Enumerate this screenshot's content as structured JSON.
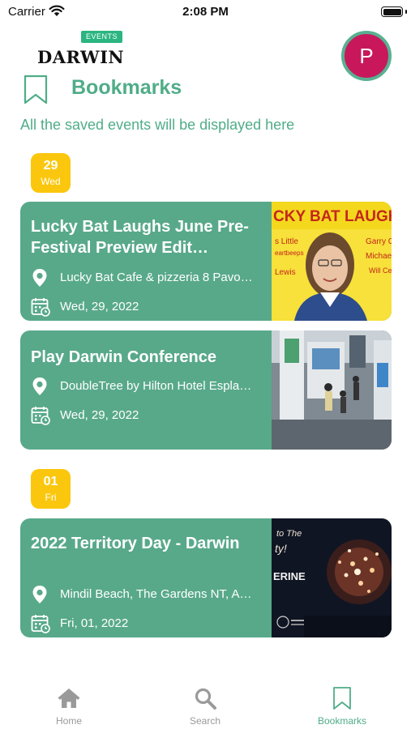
{
  "status_bar": {
    "carrier": "Carrier",
    "time": "2:08 PM"
  },
  "header": {
    "logo_tag": "EVENTS",
    "logo_word": "DARWIN",
    "avatar_initial": "P",
    "title": "Bookmarks",
    "subtitle": "All the saved events will be displayed here"
  },
  "colors": {
    "accent": "#4fad88",
    "card": "#58a98a",
    "date_chip": "#fbc70e",
    "avatar": "#c8185b"
  },
  "groups": [
    {
      "day": "29",
      "weekday": "Wed",
      "events": [
        {
          "title": "Lucky Bat Laughs June Pre-Festival Preview Edit…",
          "location": "Lucky Bat Cafe & pizzeria 8 Pavo…",
          "date": "Wed, 29, 2022",
          "image_text_top": "CKY BAT LAUGH",
          "image_text_left": [
            "s Little",
            "eartbeeps",
            "Lewis"
          ],
          "image_text_right": [
            "Garry O'",
            "Michael",
            "Will Ce"
          ]
        },
        {
          "title": "Play Darwin Conference",
          "location": "DoubleTree by Hilton Hotel Espla…",
          "date": "Wed, 29, 2022"
        }
      ]
    },
    {
      "day": "01",
      "weekday": "Fri",
      "events": [
        {
          "title": "2022 Territory Day - Darwin",
          "location": "Mindil Beach, The Gardens NT, A…",
          "date": "Fri, 01, 2022",
          "image_text_top": "to The",
          "image_text_mid": "ty!",
          "image_text_bottom": "ERINE"
        }
      ]
    }
  ],
  "tabs": [
    {
      "label": "Home",
      "icon": "home-icon",
      "active": false
    },
    {
      "label": "Search",
      "icon": "search-icon",
      "active": false
    },
    {
      "label": "Bookmarks",
      "icon": "bookmark-icon",
      "active": true
    }
  ]
}
